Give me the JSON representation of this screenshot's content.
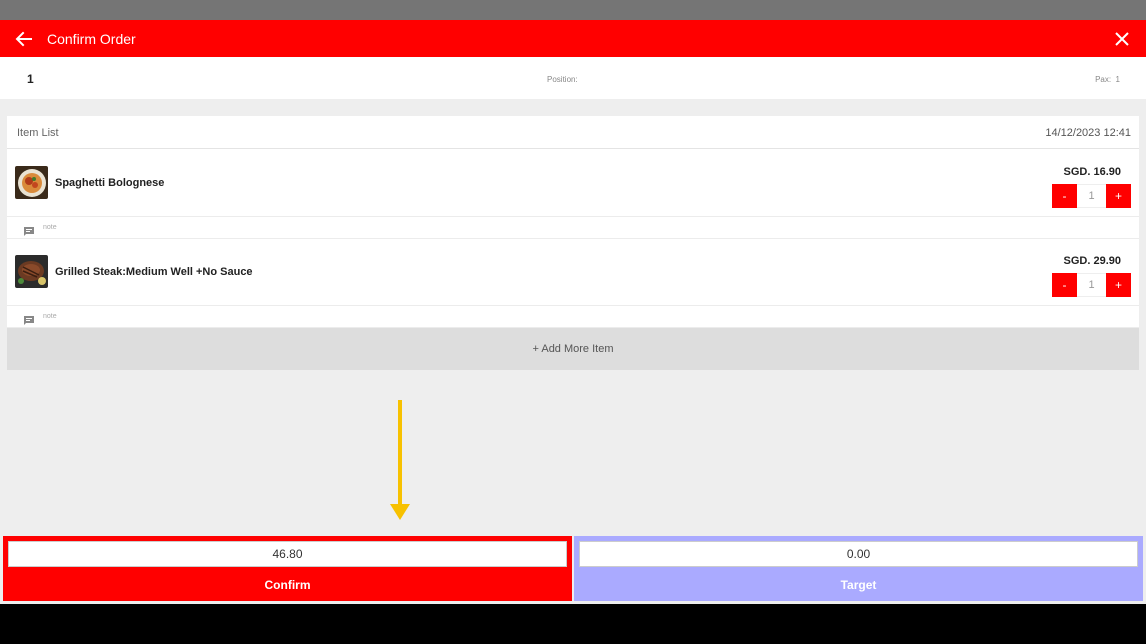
{
  "appbar": {
    "title": "Confirm Order"
  },
  "info": {
    "table_no": "1",
    "position_label": "Position:",
    "pax_label": "Pax:",
    "pax_value": "1"
  },
  "card": {
    "header_label": "Item List",
    "date": "14/12/2023 12:41",
    "items": [
      {
        "name": "Spaghetti Bolognese",
        "price": "SGD. 16.90",
        "qty": "1",
        "note": "note",
        "icon": "pasta-thumbnail"
      },
      {
        "name": "Grilled Steak:Medium Well  +No Sauce",
        "price": "SGD. 29.90",
        "qty": "1",
        "note": "note",
        "icon": "steak-thumbnail"
      }
    ],
    "add_more_label": "+ Add More Item"
  },
  "stepper": {
    "minus": "-",
    "plus": "+"
  },
  "footer": {
    "confirm_value": "46.80",
    "confirm_label": "Confirm",
    "target_value": "0.00",
    "target_label": "Target"
  },
  "colors": {
    "accent": "#ff0000",
    "target": "#aaaaff",
    "arrow": "#f7c100"
  }
}
